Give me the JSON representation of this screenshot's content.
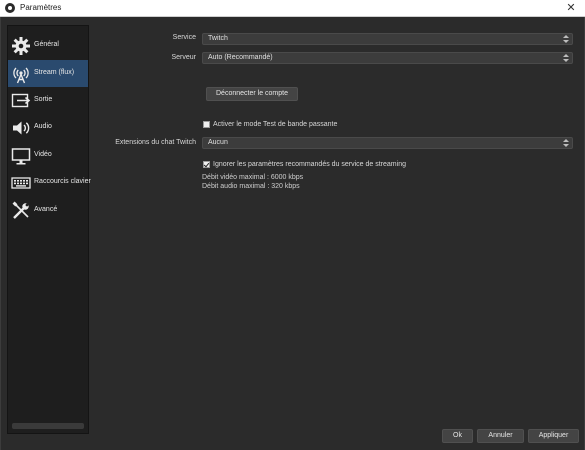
{
  "window": {
    "title": "Paramètres",
    "close_glyph": "✕"
  },
  "sidebar": {
    "items": [
      {
        "label": "Général",
        "icon": "gear-icon"
      },
      {
        "label": "Stream (flux)",
        "icon": "broadcast-icon"
      },
      {
        "label": "Sortie",
        "icon": "output-icon"
      },
      {
        "label": "Audio",
        "icon": "speaker-icon"
      },
      {
        "label": "Vidéo",
        "icon": "monitor-icon"
      },
      {
        "label": "Raccourcis clavier",
        "icon": "keyboard-icon"
      },
      {
        "label": "Avancé",
        "icon": "tools-icon"
      }
    ],
    "active_index": 1
  },
  "form": {
    "service_label": "Service",
    "service_value": "Twitch",
    "server_label": "Serveur",
    "server_value": "Auto (Recommandé)",
    "disconnect_label": "Déconnecter le compte",
    "bandwidth_test_label": "Activer le mode Test de bande passante",
    "bandwidth_test_checked": false,
    "chat_ext_label": "Extensions du chat Twitch",
    "chat_ext_value": "Aucun",
    "ignore_recommended_label": "Ignorer les paramètres recommandés du service de streaming",
    "ignore_recommended_checked": true,
    "max_video_bitrate": "Débit vidéo maximal : 6000 kbps",
    "max_audio_bitrate": "Débit audio maximal : 320 kbps"
  },
  "footer": {
    "ok_label": "Ok",
    "cancel_label": "Annuler",
    "apply_label": "Appliquer"
  },
  "colors": {
    "accent": "#2a4a6e",
    "background": "#2b2b2b",
    "sidebar": "#1e1e1e"
  }
}
